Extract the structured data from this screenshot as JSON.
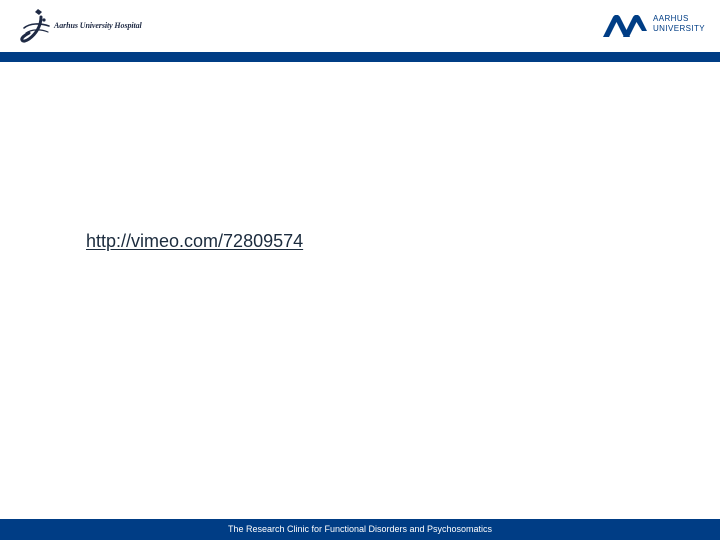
{
  "header": {
    "left_logo": {
      "name": "Aarhus University Hospital"
    },
    "right_logo": {
      "line1": "AARHUS",
      "line2": "UNIVERSITY"
    }
  },
  "colors": {
    "brand_blue": "#003d85",
    "link_text": "#1b2b3d",
    "background": "#ffffff"
  },
  "content": {
    "link_text": "http://vimeo.com/72809574"
  },
  "footer": {
    "text": "The Research Clinic for Functional Disorders and Psychosomatics"
  }
}
